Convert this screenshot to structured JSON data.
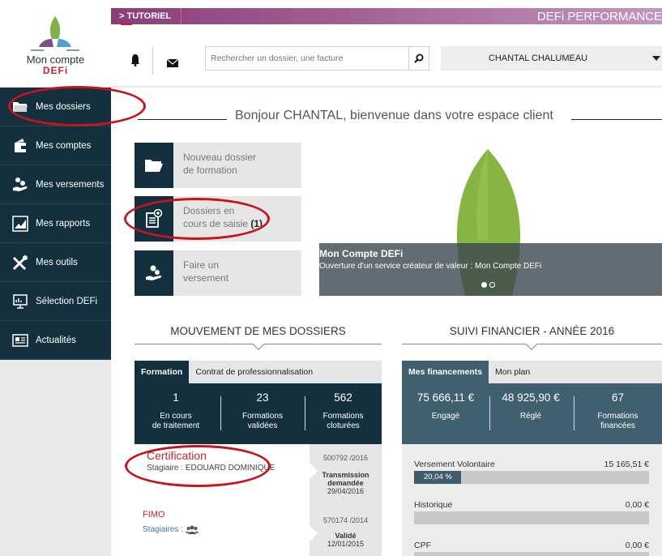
{
  "brand": {
    "logo_title": "Mon compte",
    "logo_sub": "DEFi",
    "band_title": "DEFi PERFORMANCE",
    "tutorial": "> TUTORIEL"
  },
  "sidebar": {
    "items": [
      {
        "label": "Mes dossiers",
        "icon": "folder-icon"
      },
      {
        "label": "Mes comptes",
        "icon": "wallet-icon"
      },
      {
        "label": "Mes versements",
        "icon": "hand-coins-icon"
      },
      {
        "label": "Mes rapports",
        "icon": "chart-icon"
      },
      {
        "label": "Mes outils",
        "icon": "tools-icon"
      },
      {
        "label": "Sélection DEFi",
        "icon": "presentation-icon"
      },
      {
        "label": "Actualités",
        "icon": "newspaper-icon"
      }
    ]
  },
  "header": {
    "search_placeholder": "Rechercher un dossier, une facture",
    "user_name": "CHANTAL CHALUMEAU"
  },
  "welcome": "Bonjour CHANTAL, bienvenue dans votre espace client",
  "tiles": [
    {
      "line1": "Nouveau dossier",
      "line2": "de formation",
      "count": "",
      "icon": "folder-open-icon"
    },
    {
      "line1": "Dossiers en",
      "line2": "cours de saisie",
      "count": "(1)",
      "icon": "document-add-icon"
    },
    {
      "line1": "Faire un",
      "line2": "versement",
      "icon": "hand-coins-icon"
    }
  ],
  "banner": {
    "title": "Mon Compte DEFi",
    "subtitle": "Ouverture d'un service créateur de valeur : Mon Compte DEFi"
  },
  "dossiers": {
    "title": "MOUVEMENT DE MES DOSSIERS",
    "tabs": [
      "Formation",
      "Contrat de professionnalisation"
    ],
    "stats": [
      {
        "value": "1",
        "label1": "En cours",
        "label2": "de traitement"
      },
      {
        "value": "23",
        "label1": "Formations",
        "label2": "validées"
      },
      {
        "value": "562",
        "label1": "Formations",
        "label2": "cloturées"
      }
    ],
    "items": [
      {
        "title": "Certification",
        "subtitle": "Stagiaire : EDOUARD DOMINIQUE",
        "ref": "500792 /2016",
        "status1": "Transmission",
        "status2": "demandée",
        "date": "29/04/2016"
      },
      {
        "title": "FIMO",
        "subtitle": "Stagiaires :",
        "ref": "570174 /2014",
        "status1": "Validé",
        "status2": "",
        "date": "12/01/2015"
      }
    ]
  },
  "finance": {
    "title": "SUIVI FINANCIER - ANNÉE 2016",
    "tabs": [
      "Mes financements",
      "Mon plan"
    ],
    "stats": [
      {
        "value": "75 666,11 €",
        "label1": "Engagé",
        "label2": ""
      },
      {
        "value": "48 925,90 €",
        "label1": "Réglé",
        "label2": ""
      },
      {
        "value": "67",
        "label1": "Formations",
        "label2": "financées"
      }
    ],
    "rows": [
      {
        "label": "Versement Volontaire",
        "amount": "15 165,51 €",
        "percent_label": "20,04 %",
        "percent": 20.04
      },
      {
        "label": "Historique",
        "amount": "0,00 €",
        "percent_label": "",
        "percent": 0
      },
      {
        "label": "CPF",
        "amount": "0,00 €",
        "percent_label": "",
        "percent": 0
      }
    ]
  },
  "colors": {
    "navy": "#14303e",
    "slate": "#40606f",
    "accent_red": "#c0262c",
    "band_purple": "#8a3e7a"
  }
}
